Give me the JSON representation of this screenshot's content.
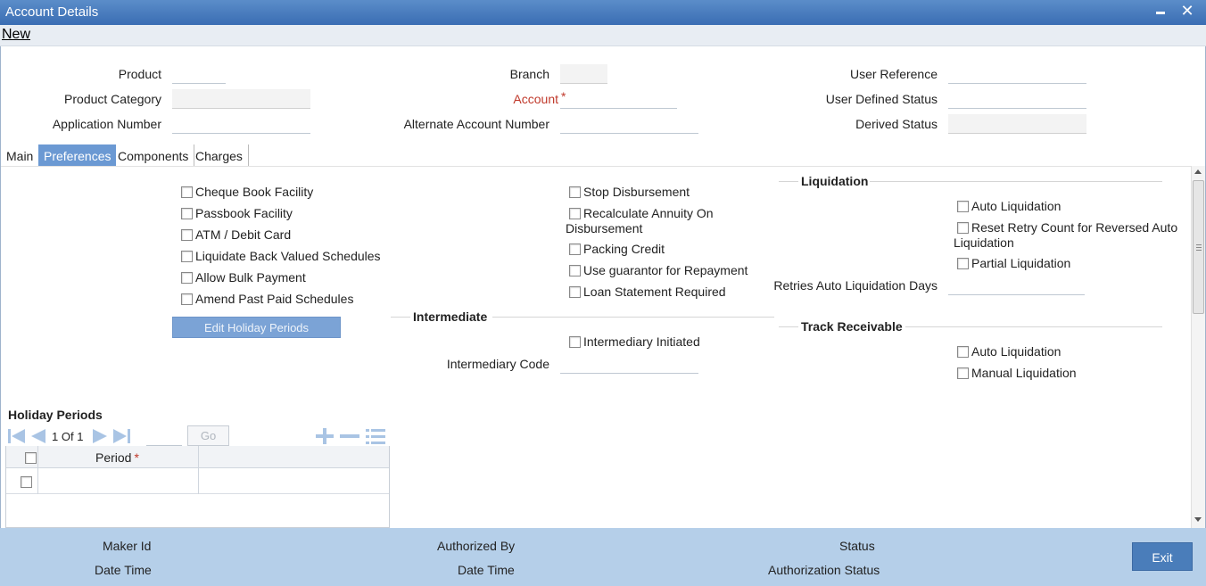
{
  "window": {
    "title": "Account Details",
    "minimize_label": "",
    "close_glyph": "✕"
  },
  "menu": {
    "new_label": "New"
  },
  "header_fields": {
    "product": "Product",
    "product_category": "Product Category",
    "application_number": "Application Number",
    "branch": "Branch",
    "account": "Account",
    "alternate_account_number": "Alternate Account Number",
    "user_reference": "User Reference",
    "user_defined_status": "User Defined Status",
    "derived_status": "Derived Status",
    "required_mark": "*"
  },
  "tabs": [
    {
      "label": "Main"
    },
    {
      "label": "Preferences"
    },
    {
      "label": "Components"
    },
    {
      "label": "Charges"
    }
  ],
  "preferences_left": [
    "Cheque Book Facility",
    "Passbook Facility",
    "ATM / Debit Card",
    "Liquidate Back Valued Schedules",
    "Allow Bulk Payment",
    "Amend Past Paid Schedules"
  ],
  "edit_holiday_label": "Edit Holiday Periods",
  "preferences_mid": {
    "stop_disbursement": "Stop Disbursement",
    "recalc_line1": "Recalculate Annuity On",
    "recalc_line2": "Disbursement",
    "packing_credit": "Packing Credit",
    "use_guarantor": "Use guarantor for Repayment",
    "loan_statement": "Loan Statement Required"
  },
  "intermediate": {
    "heading": "Intermediate",
    "initiated": "Intermediary Initiated",
    "code_label": "Intermediary Code"
  },
  "liquidation": {
    "heading": "Liquidation",
    "auto": "Auto Liquidation",
    "reset_line1": "Reset Retry Count for Reversed Auto",
    "reset_line2": "Liquidation",
    "partial": "Partial Liquidation",
    "retries_label": "Retries Auto Liquidation Days"
  },
  "track_receivable": {
    "heading": "Track Receivable",
    "auto": "Auto Liquidation",
    "manual": "Manual Liquidation"
  },
  "holiday_periods": {
    "heading": "Holiday Periods",
    "page_current": "1",
    "page_of": "Of",
    "page_total": "1",
    "go_label": "Go",
    "column_period": "Period"
  },
  "footer": {
    "maker_id": "Maker Id",
    "date_time_1": "Date Time",
    "authorized_by": "Authorized By",
    "date_time_2": "Date Time",
    "status": "Status",
    "authorization_status": "Authorization Status",
    "exit_label": "Exit"
  },
  "colors": {
    "titlebar": "#3a6db3",
    "tab_active": "#6b99d3",
    "footer": "#b5cfe9",
    "exit_button": "#4a7dba",
    "required": "#c0392b"
  }
}
